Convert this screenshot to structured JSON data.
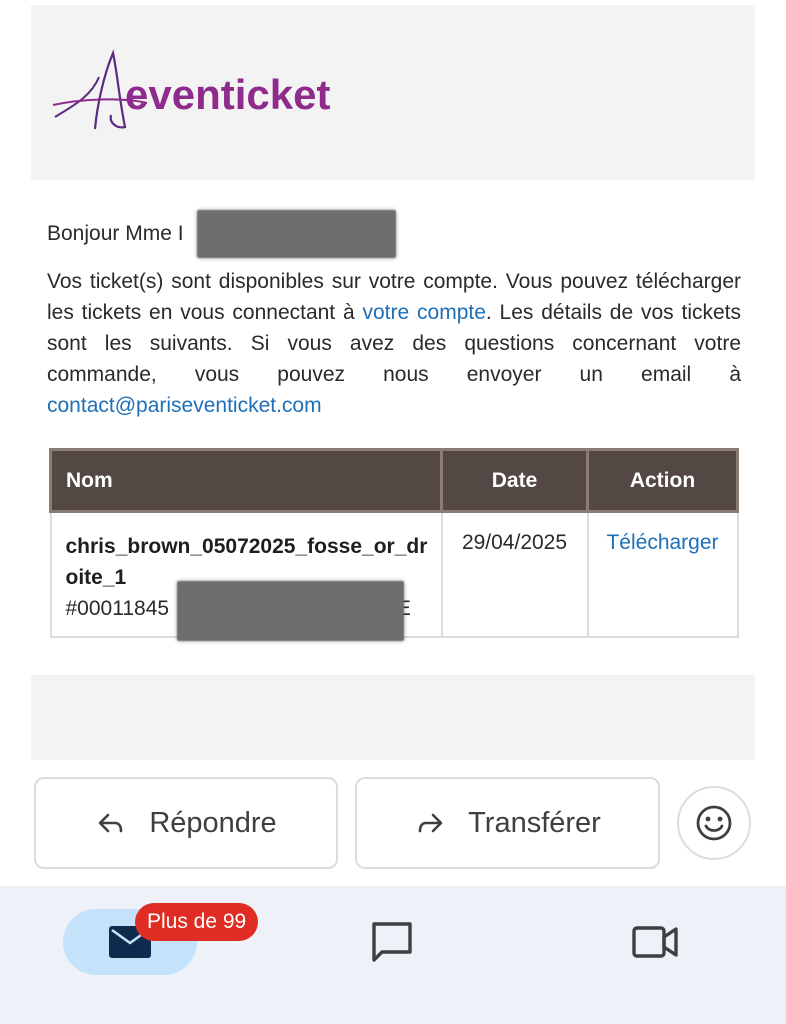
{
  "email": {
    "brand": "eventicket",
    "greeting": "Bonjour Mme I",
    "body": {
      "p1": "Vos ticket(s) sont disponibles sur votre compte. Vous pouvez télécharger les tickets en vous connectant à ",
      "account_link": "votre compte",
      "p2": ". Les détails de vos tickets sont les suivants. Si vous avez des questions concernant votre commande, vous pouvez nous envoyer un email à ",
      "email_link": "contact@pariseventicket.com"
    },
    "table": {
      "headers": {
        "name": "Nom",
        "date": "Date",
        "action": "Action"
      },
      "rows": [
        {
          "name": "chris_brown_05072025_fosse_or_droite_1",
          "ref_start": "#00011845",
          "ref_end": "IE",
          "date": "29/04/2025",
          "action": "Télécharger"
        }
      ]
    }
  },
  "actions": {
    "reply_label": "Répondre",
    "forward_label": "Transférer"
  },
  "nav": {
    "badge": "Plus de 99"
  },
  "colors": {
    "brand": "#8f2b8c",
    "link": "#1d6fb8",
    "table_header": "#534843",
    "badge": "#e02d23",
    "nav_active": "#c4e3fb",
    "nav_bg": "#eef2f8"
  }
}
